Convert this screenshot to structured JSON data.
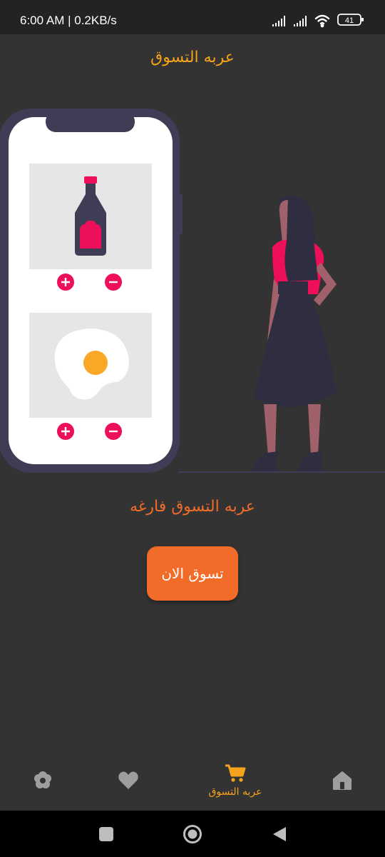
{
  "status_bar": {
    "time": "6:00 AM | 0.2KB/s",
    "battery": "41"
  },
  "header": {
    "title": "عربه التسوق"
  },
  "main": {
    "empty_message": "عربه التسوق فارغه",
    "shop_now_label": "تسوق الان"
  },
  "bottom_nav": {
    "items": [
      {
        "icon": "settings-icon"
      },
      {
        "icon": "heart-icon"
      },
      {
        "icon": "cart-icon",
        "label": "عربه التسوق"
      },
      {
        "icon": "home-icon"
      }
    ]
  },
  "colors": {
    "background": "#333333",
    "accent_orange": "#f06c28",
    "accent_yellow": "#f5a21c",
    "pink": "#ee0f5a",
    "phone_frame": "#3f3d56"
  }
}
